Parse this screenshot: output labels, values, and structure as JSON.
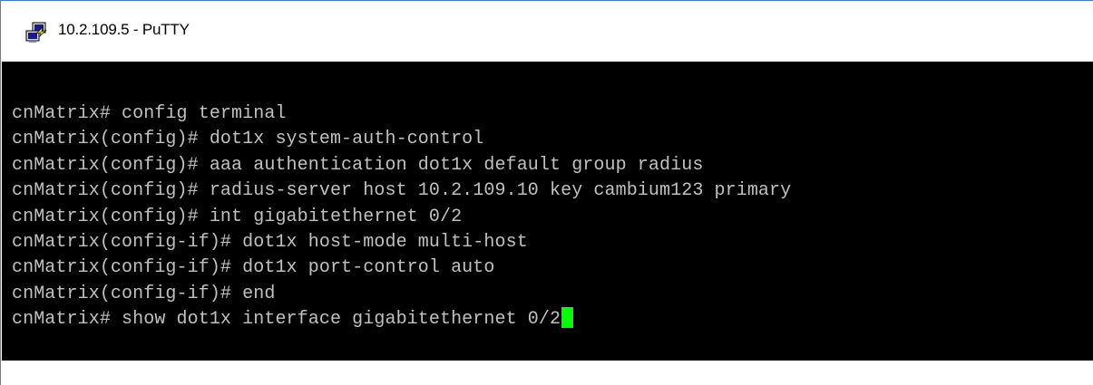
{
  "window": {
    "title": "10.2.109.5 - PuTTY",
    "icon": "putty-app-icon"
  },
  "terminal": {
    "background": "#000000",
    "foreground": "#c0c0c0",
    "cursor_color": "#00ff00",
    "lines": [
      "cnMatrix# config terminal",
      "cnMatrix(config)# dot1x system-auth-control",
      "cnMatrix(config)# aaa authentication dot1x default group radius",
      "cnMatrix(config)# radius-server host 10.2.109.10 key cambium123 primary",
      "cnMatrix(config)# int gigabitethernet 0/2",
      "cnMatrix(config-if)# dot1x host-mode multi-host",
      "cnMatrix(config-if)# dot1x port-control auto",
      "cnMatrix(config-if)# end",
      "cnMatrix# show dot1x interface gigabitethernet 0/2"
    ]
  }
}
